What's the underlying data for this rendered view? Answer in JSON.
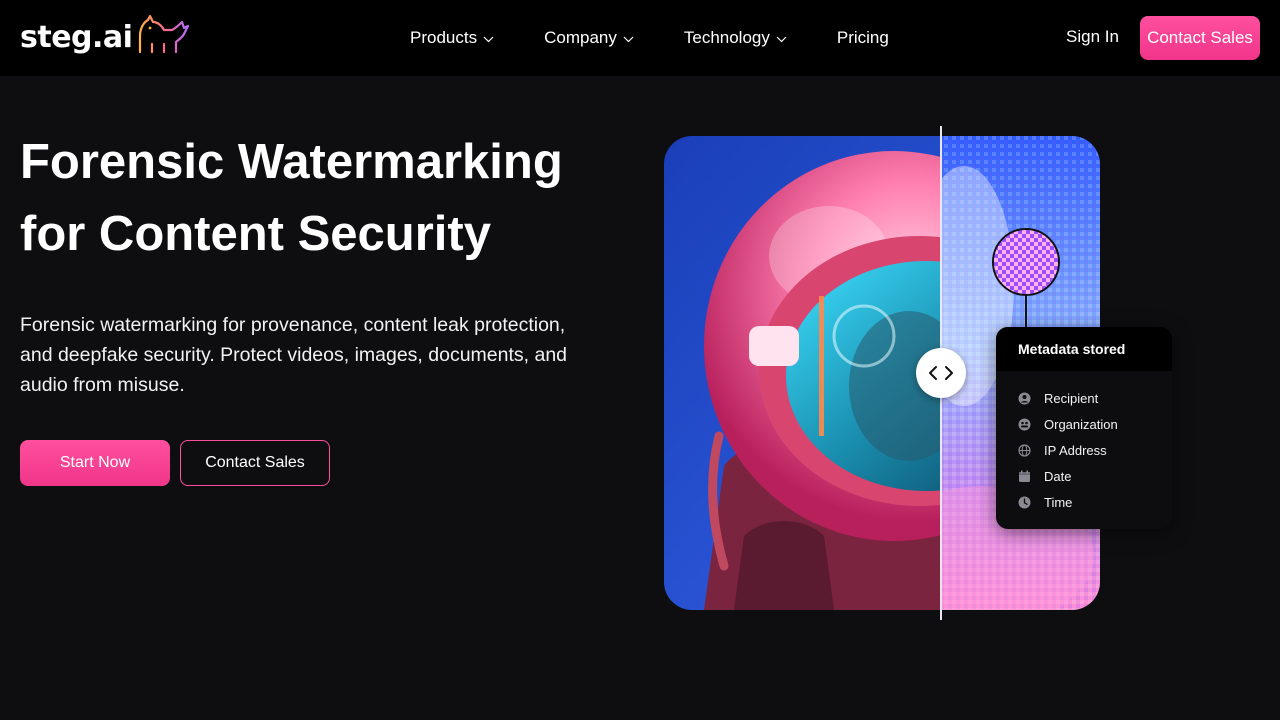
{
  "brand": {
    "name": "steg.ai",
    "accent": "#ff4f9e"
  },
  "nav": {
    "items": [
      {
        "label": "Products",
        "has_dropdown": true
      },
      {
        "label": "Company",
        "has_dropdown": true
      },
      {
        "label": "Technology",
        "has_dropdown": true
      },
      {
        "label": "Pricing",
        "has_dropdown": false
      }
    ],
    "sign_in": "Sign In",
    "contact_sales": "Contact Sales"
  },
  "hero": {
    "title_line1": "Forensic Watermarking",
    "title_line2": "for Content Security",
    "subtitle": "Forensic watermarking for provenance, content leak protection, and deepfake security. Protect videos, images, documents, and audio from misuse.",
    "primary_cta": "Start Now",
    "secondary_cta": "Contact Sales"
  },
  "visual": {
    "metadata_title": "Metadata stored",
    "metadata_fields": [
      {
        "label": "Recipient",
        "icon": "user-circle-icon"
      },
      {
        "label": "Organization",
        "icon": "organization-icon"
      },
      {
        "label": "IP Address",
        "icon": "globe-icon"
      },
      {
        "label": "Date",
        "icon": "calendar-icon"
      },
      {
        "label": "Time",
        "icon": "clock-icon"
      }
    ]
  }
}
